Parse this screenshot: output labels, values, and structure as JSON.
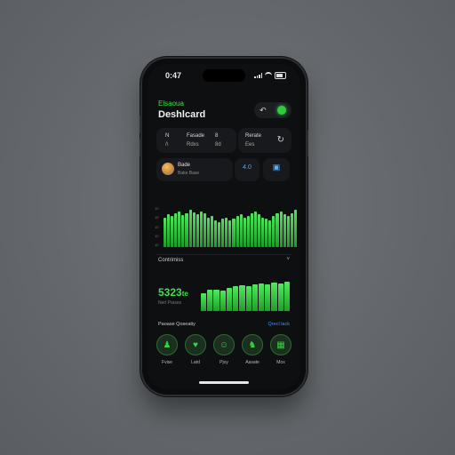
{
  "status": {
    "time": "0:47"
  },
  "header": {
    "subtitle": "Elsaoua",
    "title": "Deshlcard",
    "action_icon": "back-arrow-icon",
    "status_color": "#2ecc3c"
  },
  "stats": {
    "a": {
      "label": "N",
      "value": "/\\"
    },
    "b": {
      "label": "Fasade",
      "value": "Rdxs"
    },
    "c": {
      "label": "8",
      "value": "8d"
    },
    "d": {
      "label": "Rerate",
      "value": "Ees"
    }
  },
  "profile": {
    "name": "Bade",
    "sub": "Bake Base"
  },
  "mini": {
    "value": "4.0",
    "icon": "chart-icon"
  },
  "chart1": {
    "type": "bar",
    "ylabels": [
      "10",
      "15",
      "10",
      "10",
      "10"
    ],
    "values": [
      40,
      44,
      42,
      46,
      48,
      43,
      45,
      50,
      47,
      44,
      48,
      46,
      40,
      42,
      36,
      34,
      38,
      40,
      36,
      38,
      42,
      44,
      40,
      42,
      46,
      48,
      44,
      40,
      38,
      36,
      42,
      46,
      48,
      44,
      42,
      46,
      50
    ],
    "ymax": 55,
    "accent": "#3fdc4a"
  },
  "section": {
    "title": "Contrimiss",
    "chevron": "˅"
  },
  "big": {
    "value": "5323",
    "unit": "te",
    "sub": "Nerl Prases"
  },
  "chart2": {
    "type": "bar",
    "values": [
      20,
      24,
      24,
      23,
      26,
      28,
      29,
      28,
      30,
      31,
      30,
      32,
      31,
      33
    ],
    "ymax": 34
  },
  "quick_actions": {
    "title": "Paoase Qoseatiy",
    "link": "Qrecl lack",
    "items": [
      {
        "label": "Fvise",
        "icon": "person-icon",
        "glyph": "♟"
      },
      {
        "label": "Latd",
        "icon": "heart-icon",
        "glyph": "♥"
      },
      {
        "label": "Pjoy",
        "icon": "smile-icon",
        "glyph": "☺"
      },
      {
        "label": "Aasate",
        "icon": "person-icon",
        "glyph": "♞"
      },
      {
        "label": "Mox",
        "icon": "grid-icon",
        "glyph": "▦"
      }
    ]
  }
}
